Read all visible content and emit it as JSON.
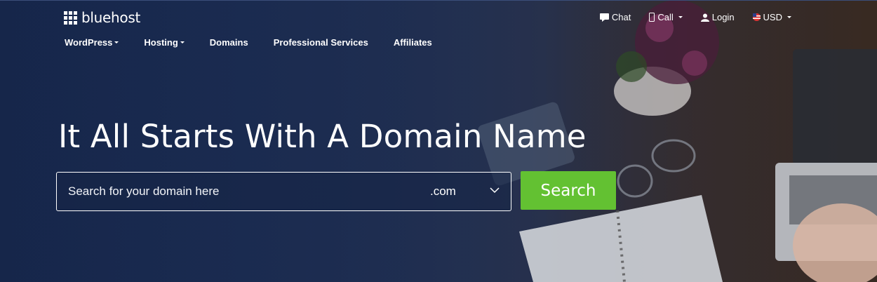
{
  "brand": {
    "name": "bluehost"
  },
  "utility": {
    "chat": "Chat",
    "call": "Call",
    "login": "Login",
    "currency": "USD"
  },
  "nav": {
    "items": [
      {
        "label": "WordPress",
        "has_dropdown": true
      },
      {
        "label": "Hosting",
        "has_dropdown": true
      },
      {
        "label": "Domains",
        "has_dropdown": false
      },
      {
        "label": "Professional Services",
        "has_dropdown": false
      },
      {
        "label": "Affiliates",
        "has_dropdown": false
      }
    ]
  },
  "hero": {
    "headline": "It All Starts With A Domain Name",
    "search_placeholder": "Search for your domain here",
    "tld_selected": ".com",
    "search_button": "Search"
  },
  "colors": {
    "background": "#1b2c52",
    "accent_green": "#63c132",
    "text": "#ffffff"
  },
  "icons": [
    "logo-grid-icon",
    "chat-icon",
    "phone-icon",
    "user-icon",
    "us-flag-icon",
    "chevron-down-icon"
  ]
}
